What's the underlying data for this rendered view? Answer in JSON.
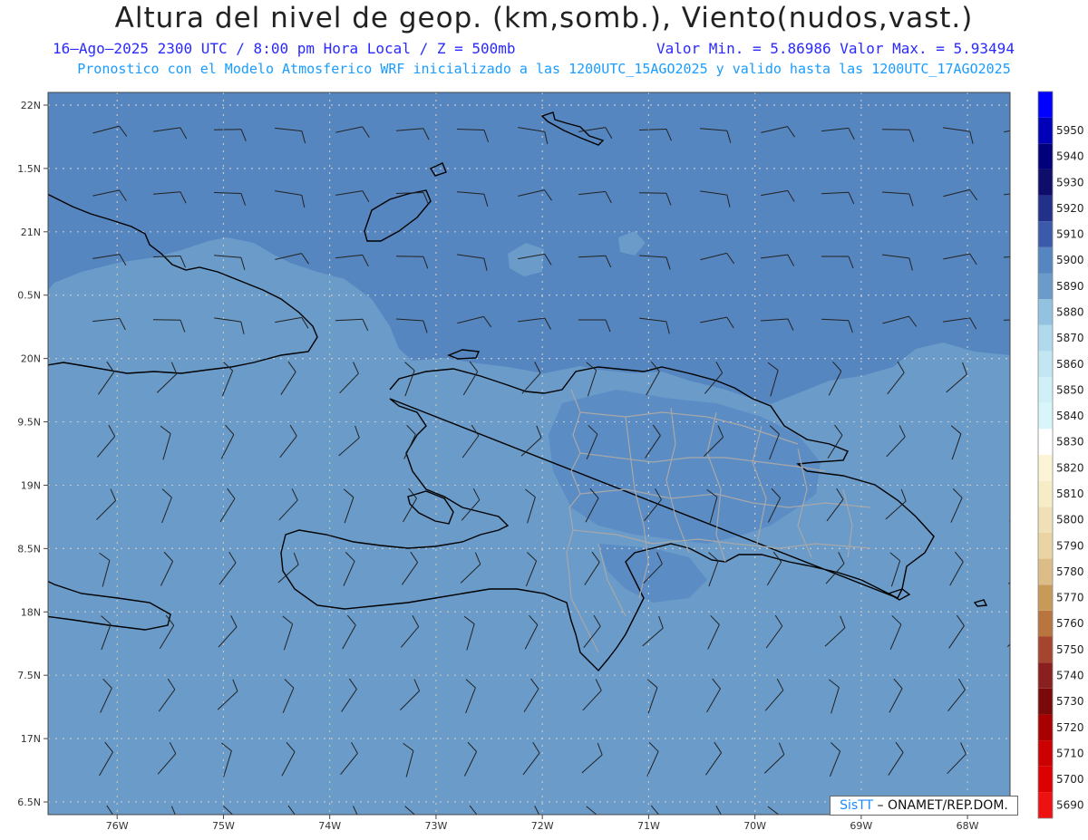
{
  "header": {
    "title": "Altura del nivel de geop. (km,somb.), Viento(nudos,vast.)",
    "subtitle_left": "16–Ago–2025  2300 UTC / 8:00 pm Hora Local / Z = 500mb",
    "subtitle_right": "Valor Min. = 5.86986  Valor Max. = 5.93494",
    "subtitle_run": "Pronostico con el Modelo Atmosferico WRF inicializado a las 1200UTC_15AGO2025 y valido hasta las  1200UTC_17AGO2025"
  },
  "map": {
    "lon_range": [
      -76.65,
      -67.6
    ],
    "lat_range": [
      16.4,
      22.1
    ],
    "lon_ticks": [
      {
        "value": -76,
        "label": "76W"
      },
      {
        "value": -75,
        "label": "75W"
      },
      {
        "value": -74,
        "label": "74W"
      },
      {
        "value": -73,
        "label": "73W"
      },
      {
        "value": -72,
        "label": "72W"
      },
      {
        "value": -71,
        "label": "71W"
      },
      {
        "value": -70,
        "label": "70W"
      },
      {
        "value": -69,
        "label": "69W"
      },
      {
        "value": -68,
        "label": "68W"
      }
    ],
    "lat_ticks": [
      {
        "value": 22,
        "label": "22N"
      },
      {
        "value": 21.5,
        "label": "1.5N"
      },
      {
        "value": 21,
        "label": "21N"
      },
      {
        "value": 20.5,
        "label": "0.5N"
      },
      {
        "value": 20,
        "label": "20N"
      },
      {
        "value": 19.5,
        "label": "9.5N"
      },
      {
        "value": 19,
        "label": "19N"
      },
      {
        "value": 18.5,
        "label": "8.5N"
      },
      {
        "value": 18,
        "label": "18N"
      },
      {
        "value": 17.5,
        "label": "7.5N"
      },
      {
        "value": 17,
        "label": "17N"
      },
      {
        "value": 16.5,
        "label": "6.5N"
      }
    ],
    "grid": true,
    "colors": {
      "field_low": "#6a9bc9",
      "field_high": "#5686c0",
      "coast": "#000000",
      "provinces": "#aaaaaa"
    }
  },
  "colorbar": {
    "levels": [
      {
        "label": "5690",
        "color": "#ee1111"
      },
      {
        "label": "5700",
        "color": "#dd0000"
      },
      {
        "label": "5710",
        "color": "#cc0000"
      },
      {
        "label": "5720",
        "color": "#a80000"
      },
      {
        "label": "5730",
        "color": "#7a0a0a"
      },
      {
        "label": "5740",
        "color": "#8a1f1f"
      },
      {
        "label": "5750",
        "color": "#a6452f"
      },
      {
        "label": "5760",
        "color": "#b8753f"
      },
      {
        "label": "5770",
        "color": "#c89a5a"
      },
      {
        "label": "5780",
        "color": "#dcbd88"
      },
      {
        "label": "5790",
        "color": "#ead4a4"
      },
      {
        "label": "5800",
        "color": "#f0e0b8"
      },
      {
        "label": "5810",
        "color": "#f6ecc6"
      },
      {
        "label": "5820",
        "color": "#fbf4d6"
      },
      {
        "label": "5830",
        "color": "#ffffff"
      },
      {
        "label": "5840",
        "color": "#d8f6fa"
      },
      {
        "label": "5850",
        "color": "#d0f0f8"
      },
      {
        "label": "5860",
        "color": "#c2e6f2"
      },
      {
        "label": "5870",
        "color": "#b0daec"
      },
      {
        "label": "5880",
        "color": "#92c2e0"
      },
      {
        "label": "5890",
        "color": "#6a9bc9"
      },
      {
        "label": "5900",
        "color": "#5686c0"
      },
      {
        "label": "5910",
        "color": "#3b5aaa"
      },
      {
        "label": "5920",
        "color": "#22308a"
      },
      {
        "label": "5930",
        "color": "#0e0e6a"
      },
      {
        "label": "5940",
        "color": "#00007a"
      },
      {
        "label": "5950",
        "color": "#0000b8"
      },
      {
        "label": "",
        "color": "#0000ff"
      }
    ]
  },
  "credit": {
    "brand": "SisTT",
    "org": " – ONAMET/REP.DOM."
  }
}
